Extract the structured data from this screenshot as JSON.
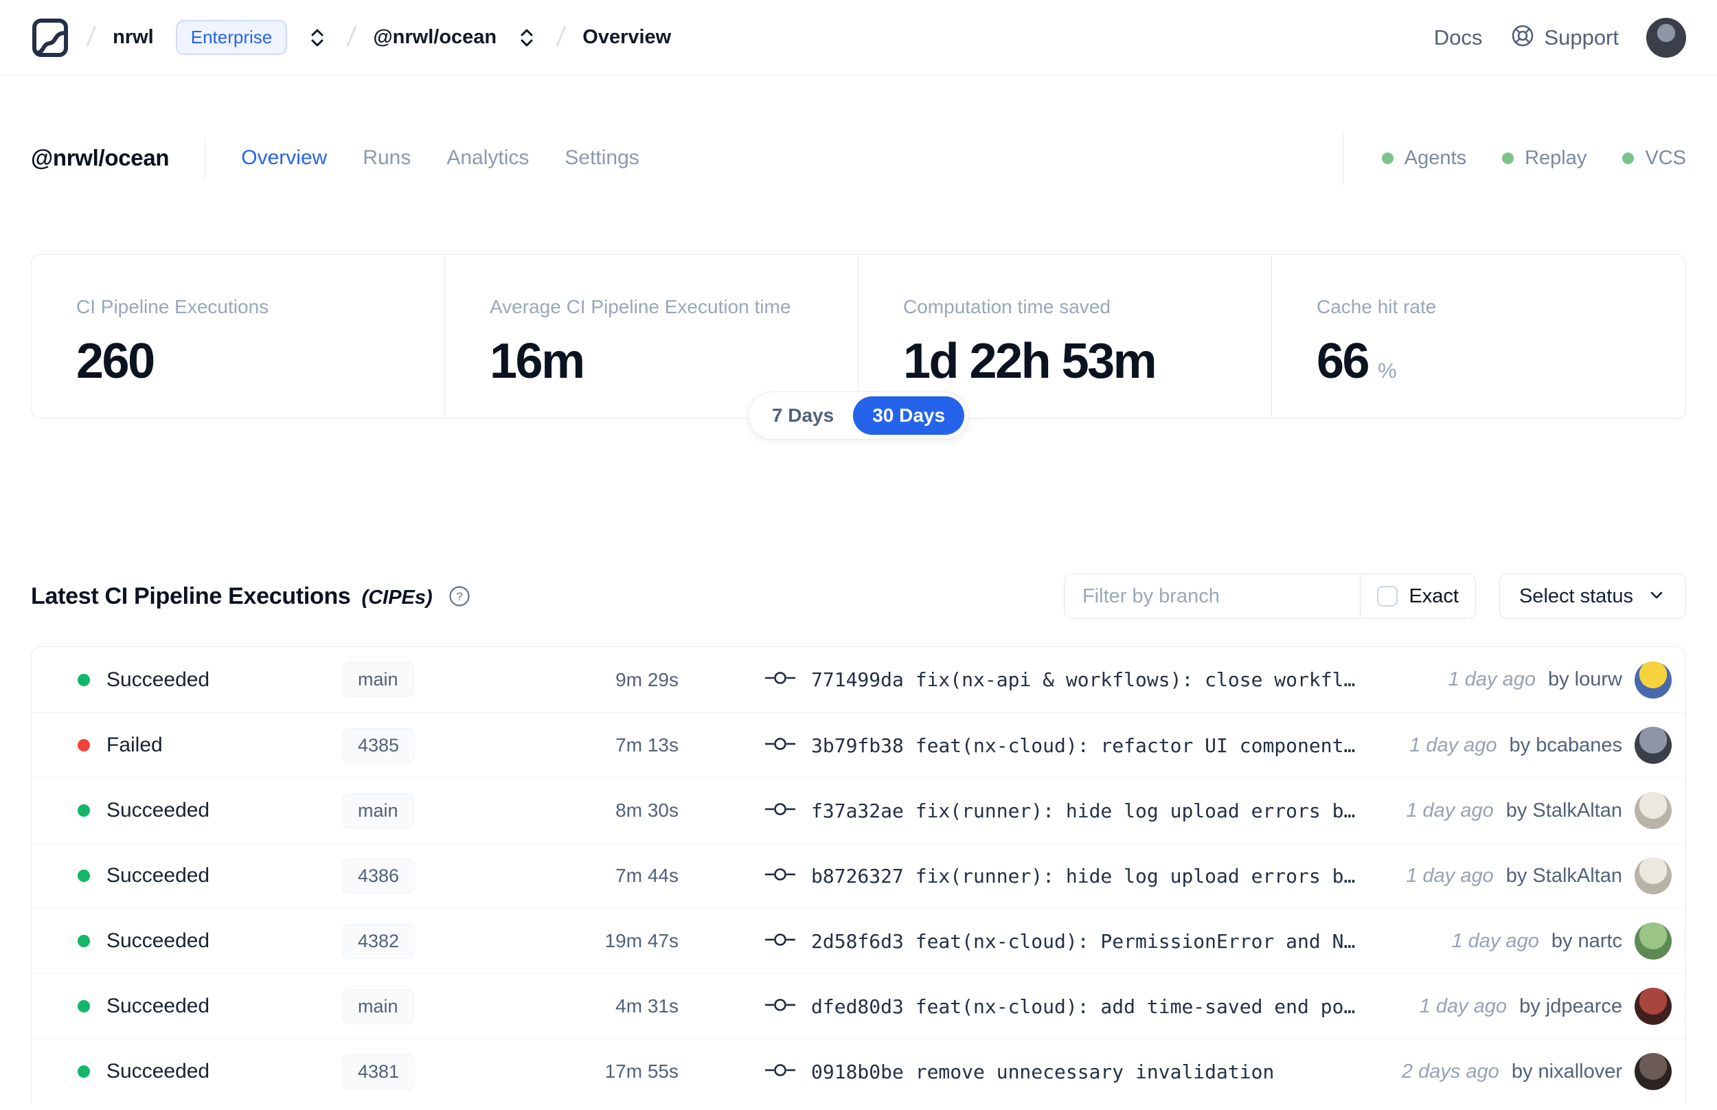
{
  "navbar": {
    "org": "nrwl",
    "plan_badge": "Enterprise",
    "workspace": "@nrwl/ocean",
    "page": "Overview",
    "docs_label": "Docs",
    "support_label": "Support"
  },
  "workspace_header": {
    "title": "@nrwl/ocean",
    "tabs": [
      {
        "label": "Overview",
        "active": true
      },
      {
        "label": "Runs",
        "active": false
      },
      {
        "label": "Analytics",
        "active": false
      },
      {
        "label": "Settings",
        "active": false
      }
    ],
    "indicators": [
      {
        "label": "Agents"
      },
      {
        "label": "Replay"
      },
      {
        "label": "VCS"
      }
    ]
  },
  "stats": {
    "cards": [
      {
        "label": "CI Pipeline Executions",
        "value": "260",
        "suffix": ""
      },
      {
        "label": "Average CI Pipeline Execution time",
        "value": "16m",
        "suffix": ""
      },
      {
        "label": "Computation time saved",
        "value": "1d 22h 53m",
        "suffix": ""
      },
      {
        "label": "Cache hit rate",
        "value": "66",
        "suffix": "%"
      }
    ],
    "range_toggle": {
      "options": [
        "7 Days",
        "30 Days"
      ],
      "selected": "30 Days"
    }
  },
  "cipe_section": {
    "title": "Latest CI Pipeline Executions",
    "title_suffix": "(CIPEs)",
    "filter_placeholder": "Filter by branch",
    "filter_value": "",
    "exact_label": "Exact",
    "status_dropdown_label": "Select status",
    "rows": [
      {
        "status": "Succeeded",
        "status_key": "succeeded",
        "branch": "main",
        "duration": "9m 29s",
        "commit": "771499da fix(nx-api & workflows): close workfl…",
        "time_ago": "1 day ago",
        "author": "by lourw",
        "avatar_colors": [
          "#f6d23c",
          "#4868b0"
        ]
      },
      {
        "status": "Failed",
        "status_key": "failed",
        "branch": "4385",
        "duration": "7m 13s",
        "commit": "3b79fb38 feat(nx-cloud): refactor UI component…",
        "time_ago": "1 day ago",
        "author": "by bcabanes",
        "avatar_colors": [
          "#8d96a5",
          "#3a3f4a"
        ]
      },
      {
        "status": "Succeeded",
        "status_key": "succeeded",
        "branch": "main",
        "duration": "8m 30s",
        "commit": "f37a32ae fix(runner): hide log upload errors b…",
        "time_ago": "1 day ago",
        "author": "by StalkAltan",
        "avatar_colors": [
          "#ece8e0",
          "#b9b3a7"
        ]
      },
      {
        "status": "Succeeded",
        "status_key": "succeeded",
        "branch": "4386",
        "duration": "7m 44s",
        "commit": "b8726327 fix(runner): hide log upload errors b…",
        "time_ago": "1 day ago",
        "author": "by StalkAltan",
        "avatar_colors": [
          "#ece8e0",
          "#b9b3a7"
        ]
      },
      {
        "status": "Succeeded",
        "status_key": "succeeded",
        "branch": "4382",
        "duration": "19m 47s",
        "commit": "2d58f6d3 feat(nx-cloud): PermissionError and N…",
        "time_ago": "1 day ago",
        "author": "by nartc",
        "avatar_colors": [
          "#9cc487",
          "#5c8a52"
        ]
      },
      {
        "status": "Succeeded",
        "status_key": "succeeded",
        "branch": "main",
        "duration": "4m 31s",
        "commit": "dfed80d3 feat(nx-cloud): add time-saved end po…",
        "time_ago": "1 day ago",
        "author": "by jdpearce",
        "avatar_colors": [
          "#a8453c",
          "#40201f"
        ]
      },
      {
        "status": "Succeeded",
        "status_key": "succeeded",
        "branch": "4381",
        "duration": "17m 55s",
        "commit": "0918b0be remove unnecessary invalidation",
        "time_ago": "2 days ago",
        "author": "by nixallover",
        "avatar_colors": [
          "#6b5a55",
          "#2b2422"
        ]
      }
    ]
  },
  "colors": {
    "accent_blue": "#2563eb",
    "succeeded": "#12b76a",
    "failed": "#f04438",
    "indicator_green": "#7bc38c"
  }
}
